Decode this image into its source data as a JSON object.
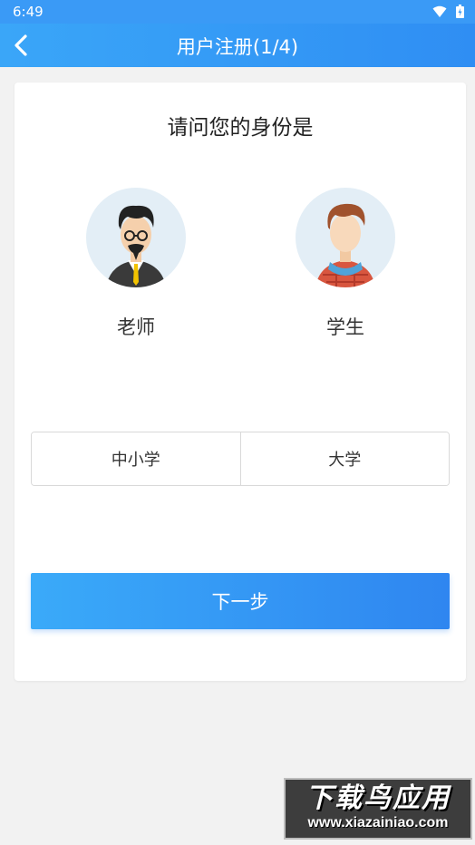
{
  "status_bar": {
    "time": "6:49"
  },
  "app_bar": {
    "title": "用户注册(1/4)"
  },
  "card": {
    "question": "请问您的身份是",
    "roles": [
      {
        "label": "老师"
      },
      {
        "label": "学生"
      }
    ],
    "segments": [
      {
        "label": "中小学"
      },
      {
        "label": "大学"
      }
    ],
    "next_button": "下一步"
  },
  "watermark": {
    "title": "下载鸟应用",
    "url": "www.xiazainiao.com"
  },
  "colors": {
    "primary": "#3a9af6",
    "button_gradient_start": "#3aaaf9",
    "button_gradient_end": "#2f86f0",
    "background": "#f2f2f2"
  }
}
